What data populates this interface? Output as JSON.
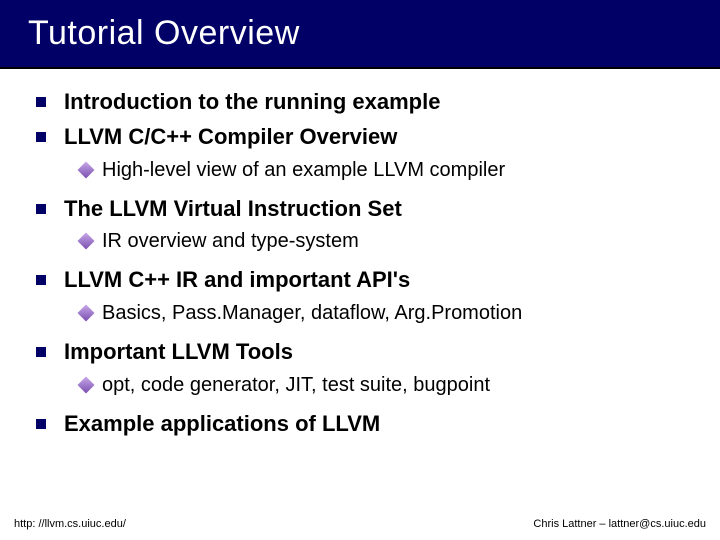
{
  "title": "Tutorial Overview",
  "items": [
    {
      "label": "Introduction to the running example",
      "bold": true,
      "sub": null
    },
    {
      "label": "LLVM C/C++ Compiler Overview",
      "bold": true,
      "sub": "High-level view of an example LLVM compiler"
    },
    {
      "label": "The LLVM Virtual Instruction Set",
      "bold": true,
      "sub": "IR overview and type-system"
    },
    {
      "label": "LLVM C++ IR and important API's",
      "bold": true,
      "sub": "Basics, Pass.Manager, dataflow, Arg.Promotion"
    },
    {
      "label": "Important LLVM Tools",
      "bold": true,
      "sub": "opt, code generator, JIT, test suite, bugpoint"
    },
    {
      "label": "Example applications of LLVM",
      "bold": true,
      "sub": null
    }
  ],
  "footer": {
    "left": "http: //llvm.cs.uiuc.edu/",
    "right": "Chris Lattner – lattner@cs.uiuc.edu"
  }
}
